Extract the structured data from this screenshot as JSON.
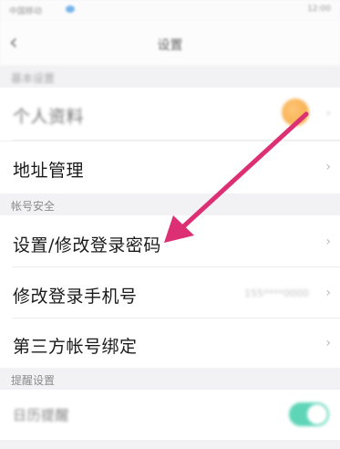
{
  "status_bar": {
    "left_text": "中国移动",
    "right_text": "12:00"
  },
  "nav": {
    "title": "设置"
  },
  "sections": {
    "personal_header": "基本设置",
    "account_header": "帐号安全",
    "reminder_header": "提醒设置"
  },
  "rows": {
    "profile": "个人资料",
    "address": "地址管理",
    "password": "设置/修改登录密码",
    "phone": "修改登录手机号",
    "phone_value": "155****0000",
    "third_party": "第三方帐号绑定",
    "calendar": "日历提醒"
  },
  "colors": {
    "arrow": "#dd2f74",
    "toggle_on": "#29c7a0",
    "avatar": "#f08a00"
  }
}
